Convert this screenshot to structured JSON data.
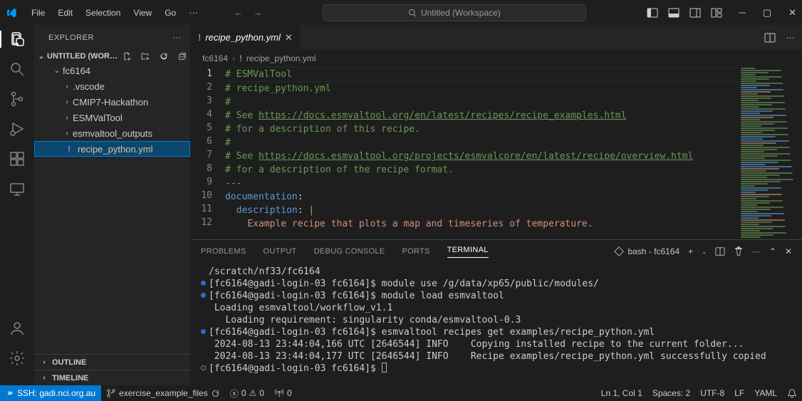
{
  "menu": {
    "items": [
      "File",
      "Edit",
      "Selection",
      "View",
      "Go"
    ],
    "moreGlyph": "···"
  },
  "titlebar": {
    "search_placeholder": "Untitled (Workspace)"
  },
  "activitybar": {
    "top": [
      "files-icon",
      "search-icon",
      "source-control-icon",
      "run-icon",
      "extensions-icon",
      "remote-explorer-icon"
    ],
    "bottom": [
      "account-icon",
      "settings-gear-icon"
    ]
  },
  "sidebar": {
    "title": "EXPLORER",
    "workspace": "UNTITLED (WOR…",
    "tree": [
      {
        "type": "folder",
        "name": "fc6164",
        "expanded": true,
        "depth": 1
      },
      {
        "type": "folder",
        "name": ".vscode",
        "expanded": false,
        "depth": 2
      },
      {
        "type": "folder",
        "name": "CMIP7-Hackathon",
        "expanded": false,
        "depth": 2
      },
      {
        "type": "folder",
        "name": "ESMValTool",
        "expanded": false,
        "depth": 2
      },
      {
        "type": "folder",
        "name": "esmvaltool_outputs",
        "expanded": false,
        "depth": 2
      },
      {
        "type": "file",
        "name": "recipe_python.yml",
        "depth": 2,
        "selected": true,
        "modified": true,
        "icon": "!"
      }
    ],
    "bottom_sections": [
      "OUTLINE",
      "TIMELINE"
    ]
  },
  "tabs": {
    "items": [
      {
        "label": "recipe_python.yml",
        "icon": "!",
        "modified": true
      }
    ]
  },
  "breadcrumbs": {
    "items": [
      {
        "label": "fc6164",
        "type": "folder"
      },
      {
        "label": "recipe_python.yml",
        "type": "file",
        "icon": "!"
      }
    ]
  },
  "editor": {
    "lines": [
      {
        "n": 1,
        "segs": [
          {
            "t": "# ESMValTool",
            "c": "comment"
          }
        ],
        "current": true
      },
      {
        "n": 2,
        "segs": [
          {
            "t": "# recipe_python.yml",
            "c": "comment"
          }
        ]
      },
      {
        "n": 3,
        "segs": [
          {
            "t": "#",
            "c": "comment"
          }
        ]
      },
      {
        "n": 4,
        "segs": [
          {
            "t": "# See ",
            "c": "comment"
          },
          {
            "t": "https://docs.esmvaltool.org/en/latest/recipes/recipe_examples.html",
            "c": "link"
          }
        ]
      },
      {
        "n": 5,
        "segs": [
          {
            "t": "# for a description of this recipe.",
            "c": "comment"
          }
        ]
      },
      {
        "n": 6,
        "segs": [
          {
            "t": "#",
            "c": "comment"
          }
        ]
      },
      {
        "n": 7,
        "segs": [
          {
            "t": "# See ",
            "c": "comment"
          },
          {
            "t": "https://docs.esmvaltool.org/projects/esmvalcore/en/latest/recipe/overview.html",
            "c": "link"
          }
        ]
      },
      {
        "n": 8,
        "segs": [
          {
            "t": "# for a description of the recipe format.",
            "c": "comment"
          }
        ]
      },
      {
        "n": 9,
        "segs": [
          {
            "t": "---",
            "c": "dash"
          }
        ]
      },
      {
        "n": 10,
        "segs": [
          {
            "t": "documentation",
            "c": "key"
          },
          {
            "t": ":",
            "c": "punct"
          }
        ]
      },
      {
        "n": 11,
        "segs": [
          {
            "t": "  ",
            "c": "punct"
          },
          {
            "t": "description",
            "c": "key"
          },
          {
            "t": ": ",
            "c": "punct"
          },
          {
            "t": "|",
            "c": "str"
          }
        ]
      },
      {
        "n": 12,
        "segs": [
          {
            "t": "    ",
            "c": "punct"
          },
          {
            "t": "Example recipe that plots a map and timeseries of temperature.",
            "c": "text"
          }
        ]
      }
    ]
  },
  "panel": {
    "tabs": [
      "PROBLEMS",
      "OUTPUT",
      "DEBUG CONSOLE",
      "PORTS",
      "TERMINAL"
    ],
    "active_tab": "TERMINAL",
    "terminal_label": "bash - fc6164",
    "terminal_lines": [
      {
        "prefix": "",
        "text": "/scratch/nf33/fc6164"
      },
      {
        "prefix": "dot",
        "text": "[fc6164@gadi-login-03 fc6164]$ module use /g/data/xp65/public/modules/"
      },
      {
        "prefix": "dot",
        "text": "[fc6164@gadi-login-03 fc6164]$ module load esmvaltool"
      },
      {
        "prefix": "",
        "text": " Loading esmvaltool/workflow_v1.1"
      },
      {
        "prefix": "",
        "text": "   Loading requirement: singularity conda/esmvaltool-0.3"
      },
      {
        "prefix": "dot",
        "text": "[fc6164@gadi-login-03 fc6164]$ esmvaltool recipes get examples/recipe_python.yml"
      },
      {
        "prefix": "",
        "text": " 2024-08-13 23:44:04,166 UTC [2646544] INFO    Copying installed recipe to the current folder..."
      },
      {
        "prefix": "",
        "text": " 2024-08-13 23:44:04,177 UTC [2646544] INFO    Recipe examples/recipe_python.yml successfully copied"
      },
      {
        "prefix": "hollow",
        "text": "[fc6164@gadi-login-03 fc6164]$ ",
        "cursor": true
      }
    ]
  },
  "statusbar": {
    "remote": "SSH: gadi.nci.org.au",
    "branch": "exercise_example_files",
    "problems_errors": "0",
    "problems_warnings": "0",
    "ports": "0",
    "cursor": "Ln 1, Col 1",
    "spaces": "Spaces: 2",
    "encoding": "UTF-8",
    "eol": "LF",
    "language": "YAML"
  }
}
